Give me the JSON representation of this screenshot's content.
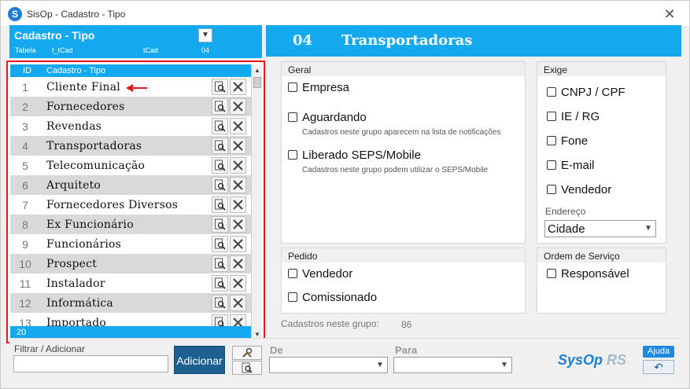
{
  "window": {
    "title": "SisOp - Cadastro - Tipo",
    "close_glyph": "✕"
  },
  "left_header": {
    "title": "Cadastro - Tipo",
    "sub_tabela": "Tabela",
    "sub_table_name": "t_tCad",
    "sub_key": "tCad",
    "sub_code": "04"
  },
  "list": {
    "header_id": "ID",
    "header_label": "Cadastro - Tipo",
    "footer_count": "20",
    "rows": [
      {
        "id": "1",
        "label": "Cliente Final"
      },
      {
        "id": "2",
        "label": "Fornecedores"
      },
      {
        "id": "3",
        "label": "Revendas"
      },
      {
        "id": "4",
        "label": "Transportadoras"
      },
      {
        "id": "5",
        "label": "Telecomunicação"
      },
      {
        "id": "6",
        "label": "Arquiteto"
      },
      {
        "id": "7",
        "label": "Fornecedores Diversos"
      },
      {
        "id": "8",
        "label": "Ex Funcionário"
      },
      {
        "id": "9",
        "label": "Funcionários"
      },
      {
        "id": "10",
        "label": "Prospect"
      },
      {
        "id": "11",
        "label": "Instalador"
      },
      {
        "id": "12",
        "label": "Informática"
      },
      {
        "id": "13",
        "label": "Importado"
      }
    ]
  },
  "detail": {
    "code": "04",
    "name": "Transportadoras"
  },
  "geral": {
    "title": "Geral",
    "empresa": "Empresa",
    "aguardando": "Aguardando",
    "aguardando_hint": "Cadastros neste grupo aparecem na lista de notificações",
    "liberado": "Liberado SEPS/Mobile",
    "liberado_hint": "Cadastros neste grupo podem utilizar o SEPS/Mobile"
  },
  "exige": {
    "title": "Exige",
    "cnpj": "CNPJ / CPF",
    "ie": "IE / RG",
    "fone": "Fone",
    "email": "E-mail",
    "vendedor": "Vendedor",
    "endereco_label": "Endereço",
    "endereco_value": "Cidade"
  },
  "pedido": {
    "title": "Pedido",
    "vendedor": "Vendedor",
    "comissionado": "Comissionado"
  },
  "ordem": {
    "title": "Ordem de Serviço",
    "responsavel": "Responsável"
  },
  "stats": {
    "label": "Cadastros neste grupo:",
    "value": "86"
  },
  "bottom": {
    "filter_label": "Filtrar / Adicionar",
    "filter_value": "",
    "add_button": "Adicionar",
    "de_label": "De",
    "de_value": "",
    "para_label": "Para",
    "para_value": "",
    "brand_main": "SysOp",
    "brand_suffix": "RS",
    "help_button": "Ajuda"
  },
  "colors": {
    "accent": "#14a9ef",
    "add_button": "#1d5f8e",
    "highlight_border": "#e51919"
  }
}
